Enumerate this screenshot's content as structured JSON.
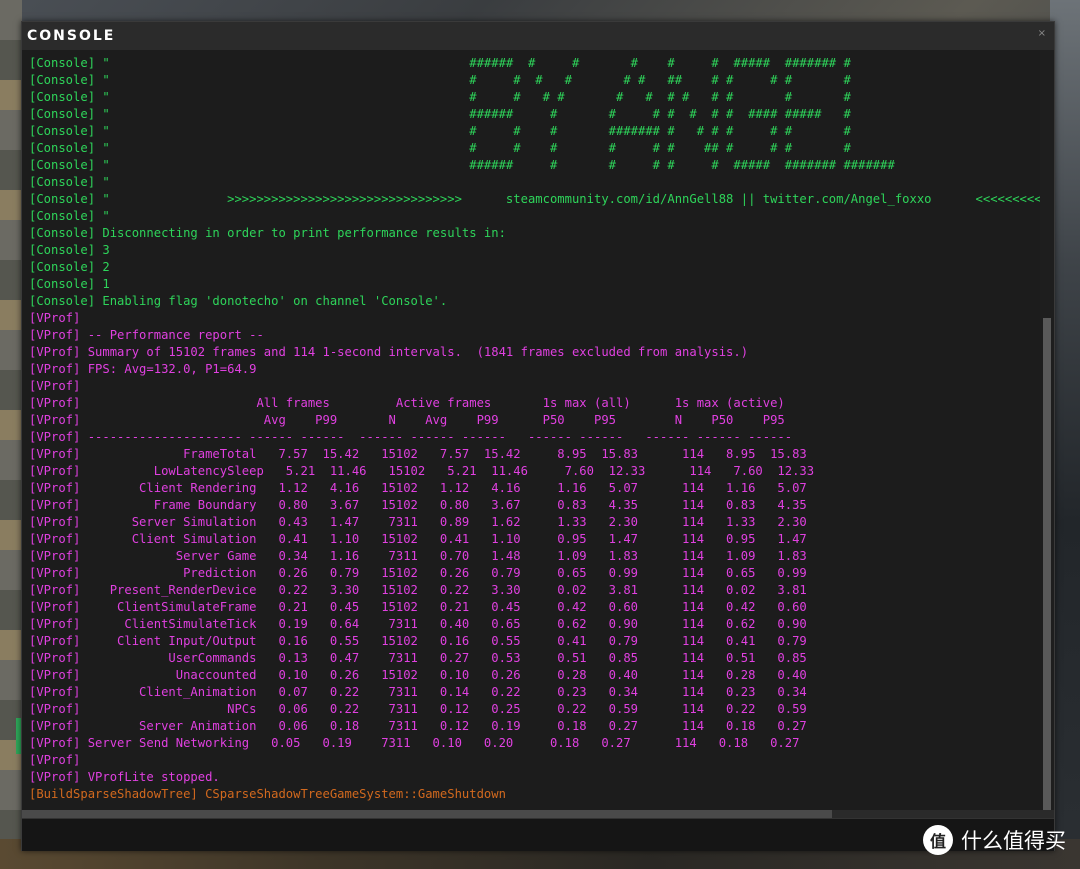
{
  "window": {
    "title": "CONSOLE",
    "close_glyph": "×"
  },
  "colors": {
    "console": "#2ed45a",
    "vprof": "#e040e0",
    "shadow": "#d2691e",
    "background": "#1c1c1c"
  },
  "console_lines": [
    "[Console] \"                                                 ######  #     #       #    #     #  #####  ####### #",
    "[Console] \"                                                 #     #  #   #       # #   ##    # #     # #       #",
    "[Console] \"                                                 #     #   # #       #   #  # #   # #       #       #",
    "[Console] \"                                                 ######     #       #     # #  #  # #  #### #####   #",
    "[Console] \"                                                 #     #    #       ####### #   # # #     # #       #",
    "[Console] \"                                                 #     #    #       #     # #    ## #     # #       #",
    "[Console] \"                                                 ######     #       #     # #     #  #####  ####### #######",
    "[Console] \"",
    "[Console] \"                >>>>>>>>>>>>>>>>>>>>>>>>>>>>>>>>      steamcommunity.com/id/AnnGell88 || twitter.com/Angel_foxxo      <<<<<<<<<<<<",
    "[Console] \"",
    "[Console] Disconnecting in order to print performance results in:",
    "[Console] 3",
    "[Console] 2",
    "[Console] 1",
    "[Console] Enabling flag 'donotecho' on channel 'Console'."
  ],
  "vprof_header": [
    "[VProf]",
    "[VProf] -- Performance report --",
    "[VProf] Summary of 15102 frames and 114 1-second intervals.  (1841 frames excluded from analysis.)",
    "[VProf] FPS: Avg=132.0, P1=64.9",
    "[VProf]",
    "[VProf]                        All frames         Active frames       1s max (all)      1s max (active)",
    "[VProf]                         Avg    P99       N    Avg    P99      P50    P95        N    P50    P95",
    "[VProf] --------------------- ------ ------  ------ ------ ------   ------ ------   ------ ------ ------"
  ],
  "vprof_rows": [
    "[VProf]              FrameTotal   7.57  15.42   15102   7.57  15.42     8.95  15.83      114   8.95  15.83",
    "[VProf]          LowLatencySleep   5.21  11.46   15102   5.21  11.46     7.60  12.33      114   7.60  12.33",
    "[VProf]        Client Rendering   1.12   4.16   15102   1.12   4.16     1.16   5.07      114   1.16   5.07",
    "[VProf]          Frame Boundary   0.80   3.67   15102   0.80   3.67     0.83   4.35      114   0.83   4.35",
    "[VProf]       Server Simulation   0.43   1.47    7311   0.89   1.62     1.33   2.30      114   1.33   2.30",
    "[VProf]       Client Simulation   0.41   1.10   15102   0.41   1.10     0.95   1.47      114   0.95   1.47",
    "[VProf]             Server Game   0.34   1.16    7311   0.70   1.48     1.09   1.83      114   1.09   1.83",
    "[VProf]              Prediction   0.26   0.79   15102   0.26   0.79     0.65   0.99      114   0.65   0.99",
    "[VProf]    Present_RenderDevice   0.22   3.30   15102   0.22   3.30     0.02   3.81      114   0.02   3.81",
    "[VProf]     ClientSimulateFrame   0.21   0.45   15102   0.21   0.45     0.42   0.60      114   0.42   0.60",
    "[VProf]      ClientSimulateTick   0.19   0.64    7311   0.40   0.65     0.62   0.90      114   0.62   0.90",
    "[VProf]     Client Input/Output   0.16   0.55   15102   0.16   0.55     0.41   0.79      114   0.41   0.79",
    "[VProf]            UserCommands   0.13   0.47    7311   0.27   0.53     0.51   0.85      114   0.51   0.85",
    "[VProf]             Unaccounted   0.10   0.26   15102   0.10   0.26     0.28   0.40      114   0.28   0.40",
    "[VProf]        Client_Animation   0.07   0.22    7311   0.14   0.22     0.23   0.34      114   0.23   0.34",
    "[VProf]                    NPCs   0.06   0.22    7311   0.12   0.25     0.22   0.59      114   0.22   0.59",
    "[VProf]        Server Animation   0.06   0.18    7311   0.12   0.19     0.18   0.27      114   0.18   0.27",
    "[VProf] Server Send Networking   0.05   0.19    7311   0.10   0.20     0.18   0.27      114   0.18   0.27"
  ],
  "vprof_footer": [
    "[VProf]",
    "[VProf] VProfLite stopped."
  ],
  "shadow_line": "[BuildSparseShadowTree] CSparseShadowTreeGameSystem::GameShutdown",
  "watermark": {
    "badge": "值",
    "text": "什么值得买"
  }
}
